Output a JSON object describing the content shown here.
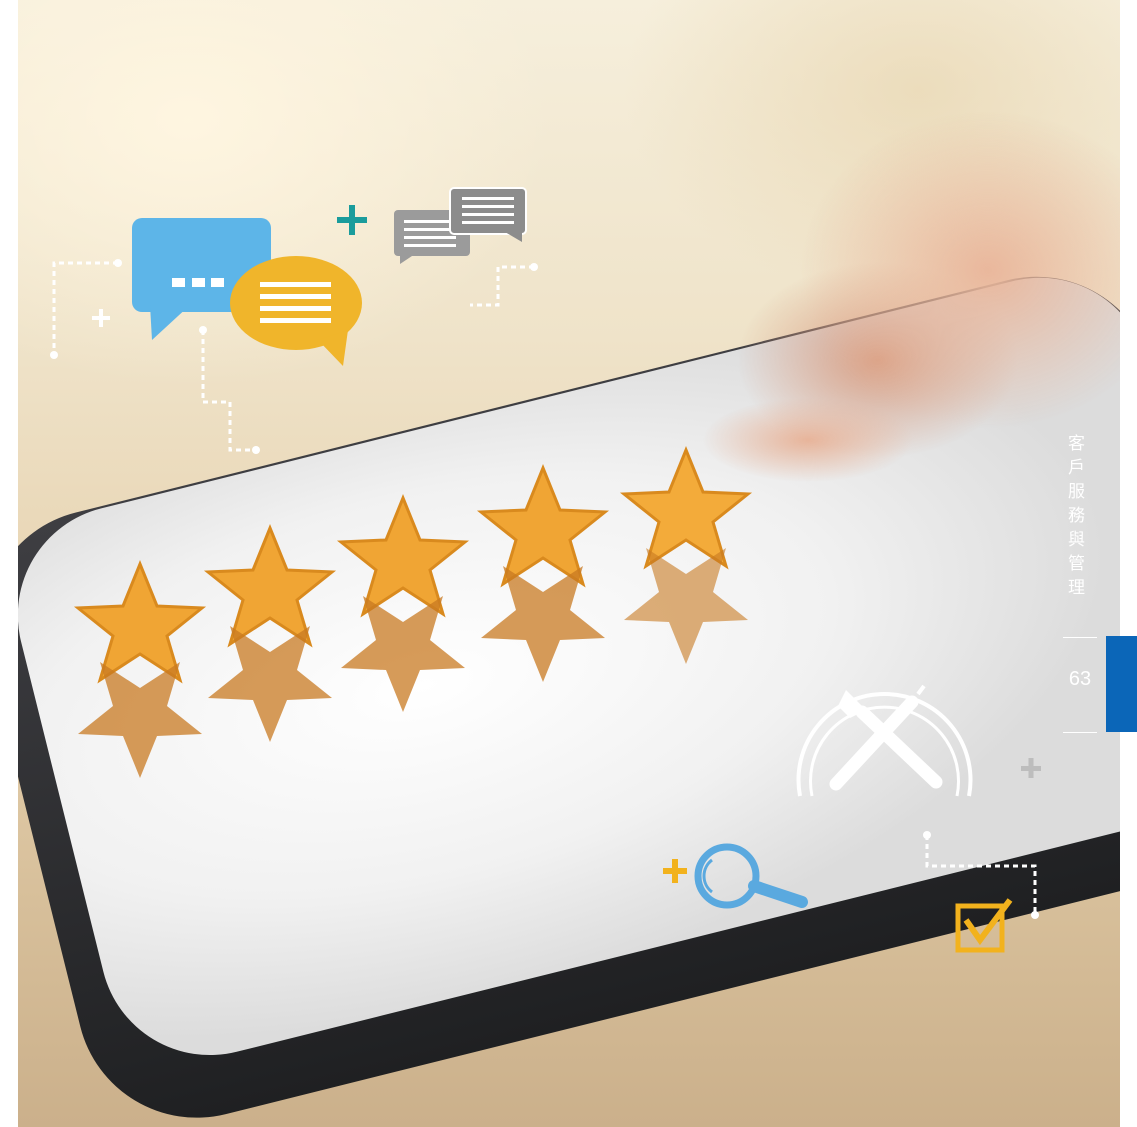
{
  "header": {
    "section_title_chars": [
      "客",
      "戶",
      "服",
      "務",
      "與",
      "管",
      "理"
    ]
  },
  "footer": {
    "page_number": "63"
  },
  "illustration": {
    "stars_count": 5,
    "icons": [
      "speech-bubble-icon",
      "chat-bubbles-icon",
      "tools-icon",
      "magnifier-icon",
      "checkbox-icon",
      "plus-icon"
    ]
  },
  "colors": {
    "tab_marker": "#0b66b8",
    "bubble_blue": "#5db5e8",
    "bubble_yellow": "#f0b52b",
    "bubble_grey": "#9b9b9b",
    "plus_teal": "#1a9c9c",
    "plus_yellow": "#f2b21d",
    "star_orange": "#f0a534"
  }
}
